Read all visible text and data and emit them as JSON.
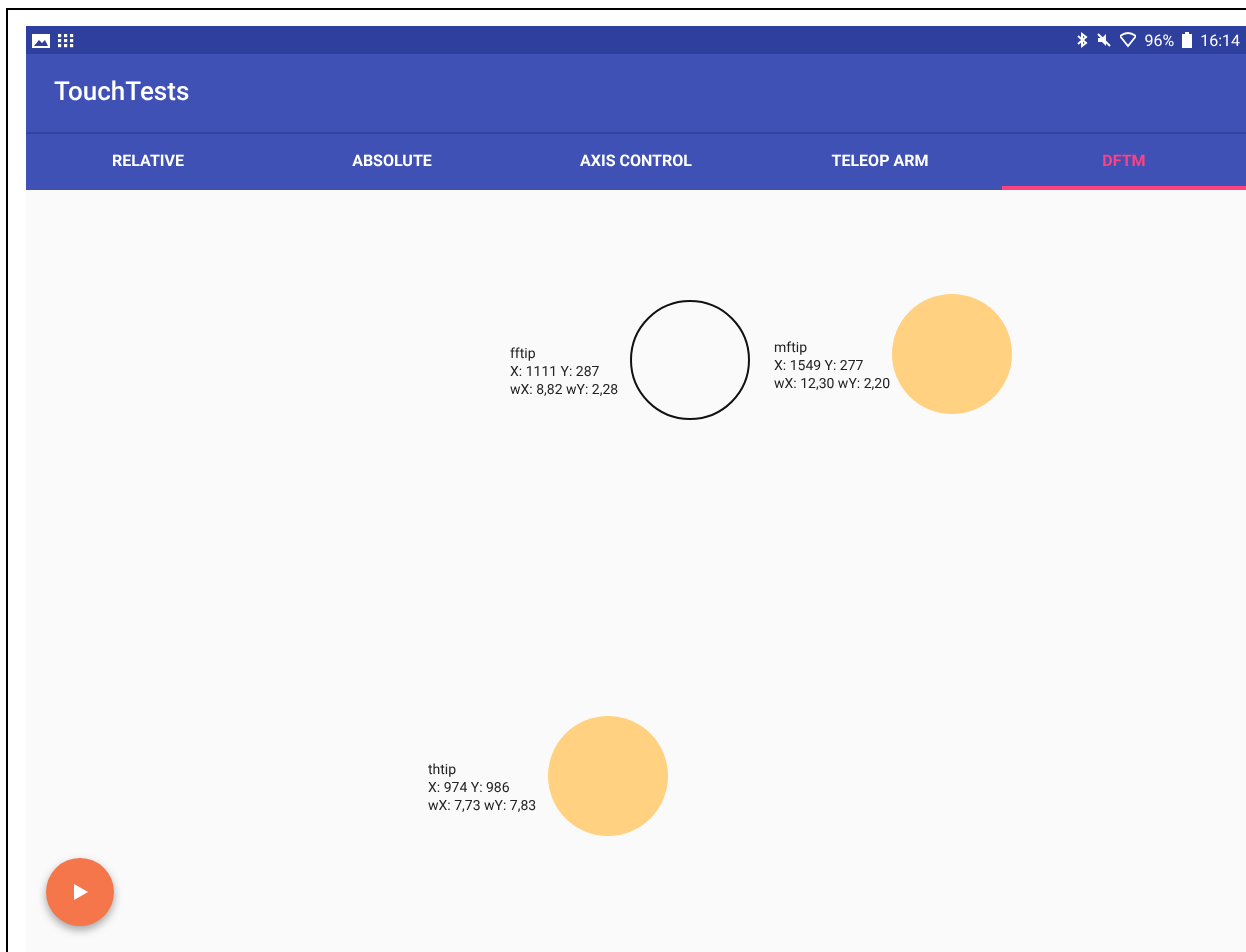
{
  "status_bar": {
    "battery": "96%",
    "time": "16:14"
  },
  "app_bar": {
    "title": "TouchTests"
  },
  "tabs": [
    {
      "label": "RELATIVE",
      "selected": false
    },
    {
      "label": "ABSOLUTE",
      "selected": false
    },
    {
      "label": "AXIS CONTROL",
      "selected": false
    },
    {
      "label": "TELEOP ARM",
      "selected": false
    },
    {
      "label": "DFTM",
      "selected": true
    }
  ],
  "touch_points": [
    {
      "name": "fftip",
      "position": "X: 1111 Y: 287",
      "weights": "wX: 8,82 wY: 2,28",
      "kind": "outline"
    },
    {
      "name": "mftip",
      "position": "X: 1549 Y: 277",
      "weights": "wX: 12,30 wY: 2,20",
      "kind": "filled"
    },
    {
      "name": "thtip",
      "position": "X: 974 Y: 986",
      "weights": "wX: 7,73 wY: 7,83",
      "kind": "filled"
    }
  ]
}
